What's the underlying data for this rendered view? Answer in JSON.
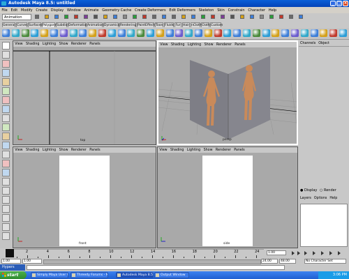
{
  "window": {
    "title": "Autodesk Maya 8.5: untitled"
  },
  "menu": [
    "File",
    "Edit",
    "Modify",
    "Create",
    "Display",
    "Window",
    "Animate",
    "Geometry Cache",
    "Create Deformers",
    "Edit Deformers",
    "Skeleton",
    "Skin",
    "Constrain",
    "Character",
    "Help"
  ],
  "status": {
    "menuset": "Animation"
  },
  "shelf_tabs": [
    "General",
    "Curves",
    "Surfaces",
    "Polygons",
    "Subdivs",
    "Deformation",
    "Animation",
    "Dynamics",
    "Rendering",
    "PaintEffects",
    "Toon",
    "Fluids",
    "Fur",
    "Hair",
    "nCloth",
    "Cloth",
    "Custom"
  ],
  "shelf_active": "Polygons",
  "panel_menu": [
    "View",
    "Shading",
    "Lighting",
    "Show",
    "Renderer",
    "Panels"
  ],
  "viewports": {
    "top": {
      "label": "top"
    },
    "persp": {
      "label": "persp"
    },
    "front": {
      "label": "front"
    },
    "side": {
      "label": "side"
    }
  },
  "channel_box": {
    "tabs": [
      "Channels",
      "Object"
    ]
  },
  "layer_editor": {
    "display": "Display",
    "render": "Render",
    "menu": [
      "Layers",
      "Options",
      "Help"
    ]
  },
  "timeline": {
    "ticks": [
      "2",
      "4",
      "6",
      "8",
      "10",
      "12",
      "14",
      "16",
      "18",
      "20",
      "22",
      "24"
    ],
    "current_frame": "1.00"
  },
  "range": {
    "start": "1.00",
    "start2": "1.00",
    "end": "24.00",
    "end2": "48.00",
    "character": "No Character Set"
  },
  "command": {
    "label": "Hypers"
  },
  "taskbar": {
    "start": "start",
    "tasks": [
      "Simply Maya User Co...",
      "Threedy Forums - Mo...",
      "Autodesk Maya 8.5: ...",
      "Output Window"
    ],
    "clock": "3:06 PM"
  },
  "colors": {
    "viewport_bg": "#a9a9a9",
    "active_border": "#ffffff",
    "figure": "#c98a5a",
    "plane": "#7e7e86",
    "titlebar": "#0a5fd8"
  }
}
